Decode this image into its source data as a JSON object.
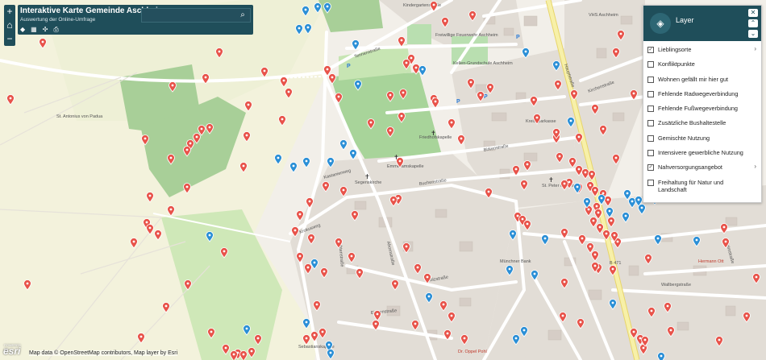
{
  "header": {
    "title": "Interaktive Karte Gemeinde Aschheim",
    "subtitle": "Auswertung der Online-Umfrage",
    "search_placeholder": ""
  },
  "map_controls": {
    "zoom_in": "+",
    "home": "⌂",
    "zoom_out": "−"
  },
  "layer_panel": {
    "title": "Layer",
    "items": [
      {
        "label": "Lieblingsorte",
        "checked": true,
        "expandable": true
      },
      {
        "label": "Konfliktpunkte",
        "checked": false,
        "expandable": false
      },
      {
        "label": "Wohnen gefällt mir hier gut",
        "checked": false,
        "expandable": false
      },
      {
        "label": "Fehlende Radwegeverbindung",
        "checked": false,
        "expandable": false
      },
      {
        "label": "Fehlende Fußwegeverbindung",
        "checked": false,
        "expandable": false
      },
      {
        "label": "Zusätzliche Bushaltestelle",
        "checked": false,
        "expandable": false
      },
      {
        "label": "Gemischte Nutzung",
        "checked": false,
        "expandable": false
      },
      {
        "label": "Intensivere gewerbliche Nutzung",
        "checked": false,
        "expandable": false
      },
      {
        "label": "Nahversorgungsangebot",
        "checked": true,
        "expandable": true
      },
      {
        "label": "Freihaltung für Natur und Landschaft",
        "checked": false,
        "expandable": false
      }
    ]
  },
  "map_labels": {
    "tennenstr": "Tennenstraße",
    "kindergarten": "Kindergartenstraße",
    "feuerwehr": "Freiwillige Feuerwehr Aschheim",
    "grundschule": "Kellen-Grundschule Aschheim",
    "vhs": "VHS Aschheim",
    "antonius": "St. Antonius von Padua",
    "friedhof": "Friedhofskapelle",
    "emmeram": "Emmeramskapelle",
    "segen": "Segenskirche",
    "kastanienweg": "Kastanienweg",
    "birkenstr": "Birkenstraße",
    "buchenstr": "Buchenstraße",
    "b471": "B 471",
    "hermann": "Hermann Ott",
    "munchner": "Münchner Bank",
    "sebastian": "Sebastianskapelle",
    "drospel": "Dr. Oppel Pohl",
    "wallberg": "Wallbergstraße",
    "holzstr": "Holzstraße",
    "fichtenstr": "Fichtenstraße",
    "ahornstr": "Ahornstraße",
    "krokus": "Krokusweg",
    "eichenstr": "Eichenstraße",
    "hauptstr": "Hauptstraße",
    "heimstr": "Heimstraße",
    "stpeter": "St. Peter und Paul",
    "kreissparkasse": "Kreissparkasse",
    "kirchen": "Kirchenstraße"
  },
  "attribution": "Map data © OpenStreetMap contributors, Map layer by Esri",
  "esri_logo": "esri",
  "esri_powered": "POWERED BY",
  "colors": {
    "red_marker": "#e8534a",
    "blue_marker": "#2b8fd6",
    "header": "#1f4e5a",
    "road": "#ffffff",
    "field": "#f0f0dc",
    "park": "#a8d49a",
    "building": "#d9d0c9",
    "main_road": "#f7f0a8"
  }
}
